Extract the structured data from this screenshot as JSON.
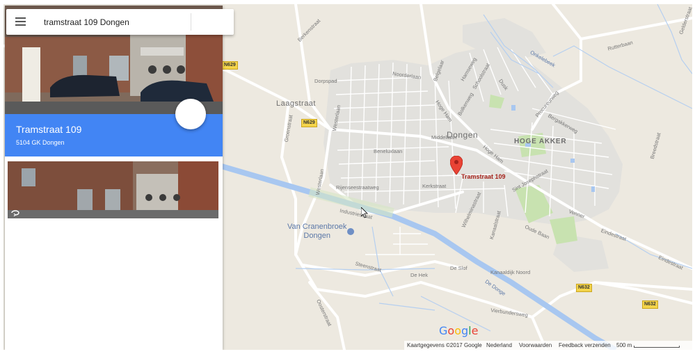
{
  "search": {
    "query": "tramstraat 109 Dongen"
  },
  "place": {
    "name": "Tramstraat 109",
    "address": "5104 GK Dongen"
  },
  "marker_label": "Tramstraat 109",
  "labels": {
    "towns": [
      "Laagstraat",
      "Dongen"
    ],
    "districts": [
      "HOGE AKKER"
    ],
    "poi": [
      "Van Cranenbroek",
      "Dongen"
    ],
    "streets": [
      "Berkenstraat",
      "Dorpspad",
      "Noorderlaan",
      "Belgelaar",
      "Hamseweg",
      "Schoolstraat",
      "Dusk",
      "Hoge Ham",
      "Bolkenweg",
      "Procureurweg",
      "Burgweg",
      "Bergakkerweg",
      "Breedstraat",
      "Onkelebeek",
      "Rutterbaan",
      "Middellaan",
      "Groenstraat",
      "Westerlaan",
      "Beneluxlaan",
      "Hoge Ham",
      "Sint Josephstraat",
      "Rijenseestraatweg",
      "Kerkstraat",
      "Wilhelminastraat",
      "Kanaalstraat",
      "Oude Baan",
      "Venner",
      "Eindestraat",
      "Eindestraat",
      "Industriestraat",
      "Steenstraat",
      "De Slof",
      "De Hek",
      "Kanaaldijk Noord",
      "De Donge",
      "Vierbundersweg",
      "Oosterstraat",
      "Gelderstraat"
    ],
    "roads": [
      "N629",
      "N629",
      "N632",
      "N632"
    ]
  },
  "logo": "Google",
  "footer": {
    "copyright": "Kaartgegevens ©2017 Google",
    "country": "Nederland",
    "terms": "Voorwaarden",
    "feedback": "Feedback verzenden",
    "scale": "500 m"
  },
  "colors": {
    "accent": "#4285f4",
    "marker": "#e94335",
    "map_bg": "#ede9e0",
    "water": "#a8c7f0"
  },
  "icons": {
    "menu": "menu-icon",
    "marker": "map-pin-icon",
    "street_view": "street-view-icon"
  }
}
